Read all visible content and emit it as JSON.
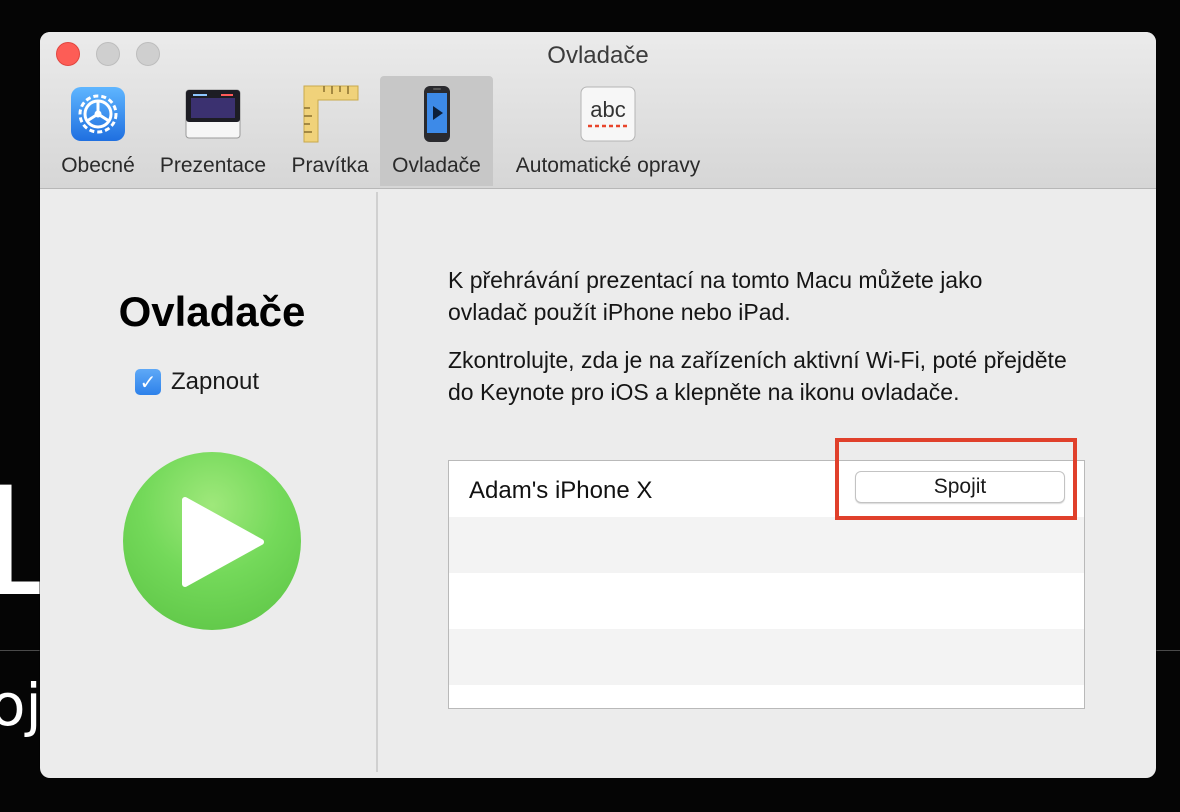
{
  "background": {
    "letter": "L",
    "text": "oj"
  },
  "window": {
    "title": "Ovladače",
    "toolbar": {
      "tabs": [
        {
          "label": "Obecné",
          "icon": "gear-icon"
        },
        {
          "label": "Prezentace",
          "icon": "presentation-icon"
        },
        {
          "label": "Pravítka",
          "icon": "ruler-icon"
        },
        {
          "label": "Ovladače",
          "icon": "remote-device-icon",
          "selected": true
        },
        {
          "label": "Automatické opravy",
          "icon": "abc-spelling-icon"
        }
      ],
      "abc_icon_text": "abc"
    }
  },
  "sidebar": {
    "title": "Ovladače",
    "enable_label": "Zapnout",
    "enable_checked": true,
    "checkbox_mark": "✓",
    "play_icon": "play-icon"
  },
  "main": {
    "paragraph1": "K přehrávání prezentací na tomto Macu můžete jako ovladač použít iPhone nebo iPad.",
    "paragraph2": "Zkontrolujte, zda je na zařízeních aktivní Wi-Fi, poté přejděte do Keynote pro iOS a klepněte na ikonu ovladače.",
    "devices": [
      {
        "name": "Adam's iPhone X",
        "action": "Spojit"
      }
    ]
  },
  "colors": {
    "accent_blue": "#2d81ea",
    "play_green": "#74d95a",
    "highlight_red": "#e0402b",
    "close_red": "#fd5d56"
  }
}
